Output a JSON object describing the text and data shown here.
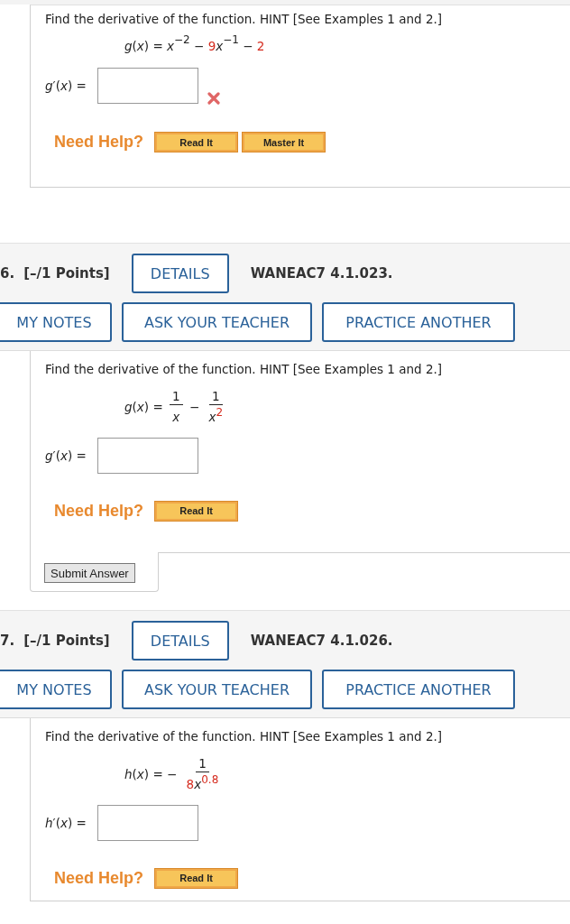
{
  "questions": [
    {
      "prompt": "Find the derivative of the function. HINT [See Examples 1 and 2.]",
      "equation": [
        {
          "kind": "txt",
          "text": "*g*(*x*) = *x*",
          "red": false
        },
        {
          "kind": "sup",
          "text": "−2",
          "red": false
        },
        {
          "kind": "txt",
          "text": " − ",
          "red": false
        },
        {
          "kind": "txt",
          "text": "9",
          "red": true
        },
        {
          "kind": "txt",
          "text": "*x*",
          "red": false
        },
        {
          "kind": "sup",
          "text": "−1",
          "red": false
        },
        {
          "kind": "txt",
          "text": " − ",
          "red": false
        },
        {
          "kind": "txt",
          "text": "2",
          "red": true
        }
      ],
      "answer_label": "*g*′(*x*) =",
      "incorrect": true,
      "help_label": "Need Help?",
      "help_buttons": [
        "Read It",
        "Master It"
      ]
    },
    {
      "header": {
        "number": "6.",
        "points": "[–/1 Points]",
        "details": "DETAILS",
        "code": "WANEAC7 4.1.023.",
        "actions": [
          "MY NOTES",
          "ASK YOUR TEACHER",
          "PRACTICE ANOTHER"
        ]
      },
      "prompt": "Find the derivative of the function. HINT [See Examples 1 and 2.]",
      "equation": [
        {
          "kind": "txt",
          "text": "*g*(*x*) = ",
          "red": false
        },
        {
          "kind": "frac",
          "num": [
            {
              "kind": "txt",
              "text": "1",
              "red": false
            }
          ],
          "den": [
            {
              "kind": "txt",
              "text": "*x*",
              "red": false
            }
          ]
        },
        {
          "kind": "txt",
          "text": " − ",
          "red": false
        },
        {
          "kind": "frac",
          "num": [
            {
              "kind": "txt",
              "text": "1",
              "red": false
            }
          ],
          "den": [
            {
              "kind": "txt",
              "text": "*x*",
              "red": false
            },
            {
              "kind": "sup",
              "text": "2",
              "red": true
            }
          ]
        }
      ],
      "answer_label": "*g*′(*x*) =",
      "incorrect": false,
      "help_label": "Need Help?",
      "help_buttons": [
        "Read It"
      ],
      "submit": "Submit Answer"
    },
    {
      "header": {
        "number": "7.",
        "points": "[–/1 Points]",
        "details": "DETAILS",
        "code": "WANEAC7 4.1.026.",
        "actions": [
          "MY NOTES",
          "ASK YOUR TEACHER",
          "PRACTICE ANOTHER"
        ]
      },
      "prompt": "Find the derivative of the function. HINT [See Examples 1 and 2.]",
      "equation": [
        {
          "kind": "txt",
          "text": "*h*(*x*) = − ",
          "red": false
        },
        {
          "kind": "frac",
          "num": [
            {
              "kind": "txt",
              "text": "1",
              "red": false
            }
          ],
          "den": [
            {
              "kind": "txt",
              "text": "8",
              "red": true
            },
            {
              "kind": "txt",
              "text": "*x*",
              "red": false
            },
            {
              "kind": "sup",
              "text": "0.8",
              "red": true
            }
          ]
        }
      ],
      "answer_label": "*h*′(*x*) =",
      "incorrect": false,
      "help_label": "Need Help?",
      "help_buttons": [
        "Read It"
      ]
    }
  ]
}
